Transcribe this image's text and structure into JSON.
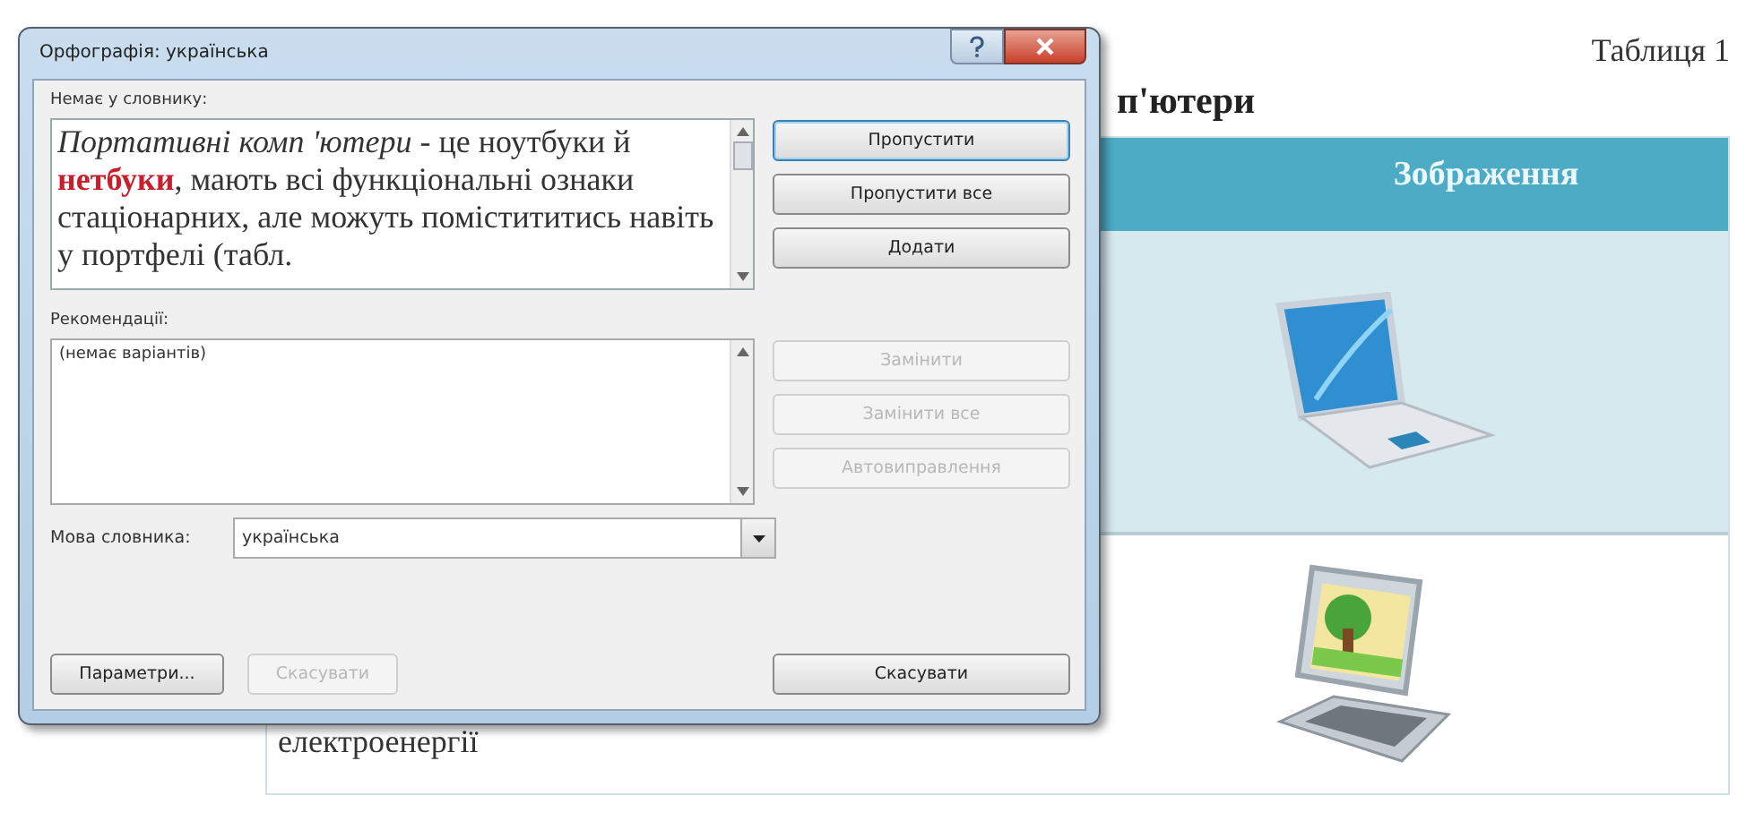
{
  "document": {
    "table_caption": "Таблиця 1",
    "heading": "п'ютери",
    "table": {
      "header": "Зображення",
      "rows": [
        {
          "text": ""
        },
        {
          "text": "електроенергії"
        }
      ]
    }
  },
  "dialog": {
    "title": "Орфографія: українська",
    "not_in_dictionary": {
      "label": "Немає у словнику:",
      "segments": [
        {
          "text": "Портативні комп 'ютери",
          "kind": "italic"
        },
        {
          "text": " - це ноутбуки й ",
          "kind": "plain"
        },
        {
          "text": "нетбуки",
          "kind": "error"
        },
        {
          "text": ", мають всі функціональні ознаки стаціонарних, але можуть помістититись навіть у портфелі (табл.",
          "kind": "plain"
        }
      ]
    },
    "top_buttons": [
      {
        "label": "Пропустити",
        "disabled": false,
        "default": true
      },
      {
        "label": "Пропустити все",
        "disabled": false,
        "default": false
      },
      {
        "label": "Додати",
        "disabled": false,
        "default": false
      }
    ],
    "suggestions": {
      "label": "Рекомендації:",
      "items": [
        "(немає варіантів)"
      ]
    },
    "suggestion_buttons": [
      {
        "label": "Замінити",
        "disabled": true
      },
      {
        "label": "Замінити все",
        "disabled": true
      },
      {
        "label": "Автовиправлення",
        "disabled": true
      }
    ],
    "language": {
      "label": "Мова словника:",
      "value": "українська"
    },
    "bottom_buttons": [
      {
        "label": "Параметри...",
        "disabled": false
      },
      {
        "label": "Скасувати",
        "disabled": true
      }
    ],
    "cancel_button": {
      "label": "Скасувати",
      "disabled": false
    }
  }
}
